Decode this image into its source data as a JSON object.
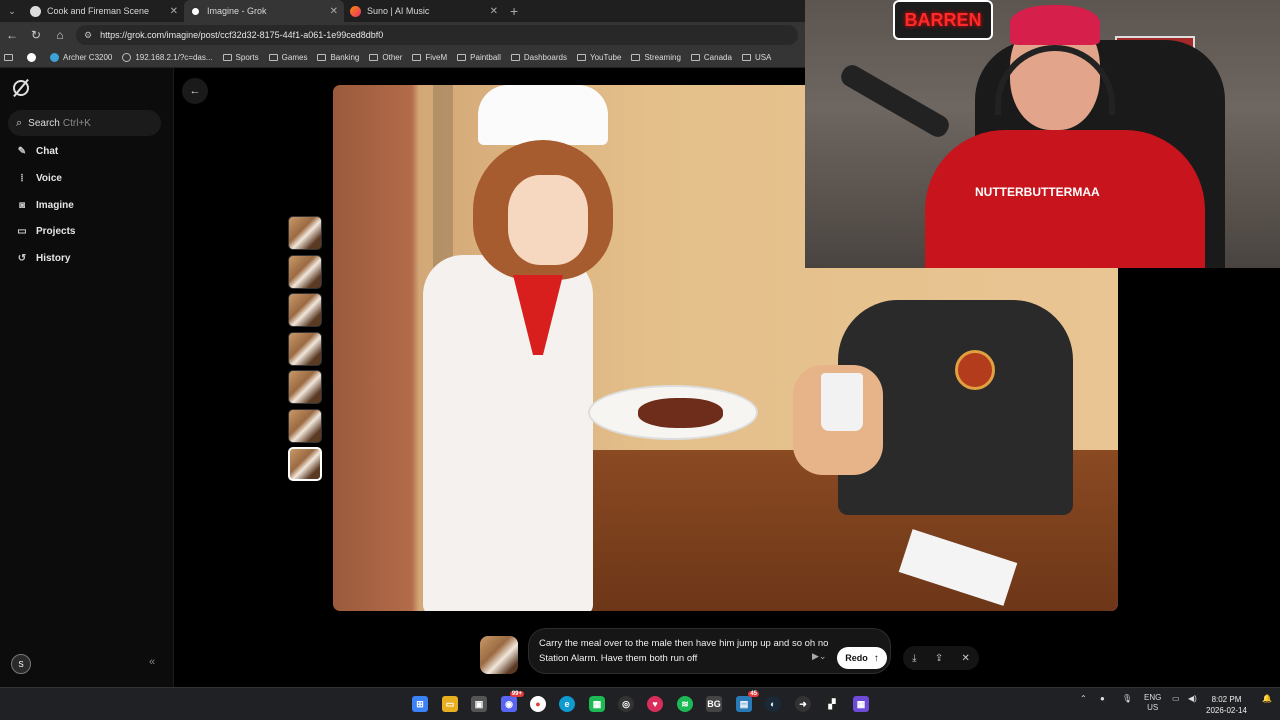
{
  "browser": {
    "tabs": [
      {
        "title": "Cook and Fireman Scene",
        "icon": "chat-bubble-icon"
      },
      {
        "title": "Imagine - Grok",
        "icon": "grok-logo-icon"
      },
      {
        "title": "Suno | AI Music",
        "icon": "suno-logo-icon"
      }
    ],
    "url": "https://grok.com/imagine/post/ccf32d32-8175-44f1-a061-1e99ced8dbf0",
    "bookmarks": [
      {
        "label": "",
        "icon": "google-icon"
      },
      {
        "label": "Archer C3200",
        "icon": "router-icon"
      },
      {
        "label": "192.168.2.1/?c=das...",
        "icon": "globe-icon"
      },
      {
        "label": "Sports",
        "icon": "folder-icon"
      },
      {
        "label": "Games",
        "icon": "folder-icon"
      },
      {
        "label": "Banking",
        "icon": "folder-icon"
      },
      {
        "label": "Other",
        "icon": "folder-icon"
      },
      {
        "label": "FiveM",
        "icon": "folder-icon"
      },
      {
        "label": "Paintball",
        "icon": "folder-icon"
      },
      {
        "label": "Dashboards",
        "icon": "folder-icon"
      },
      {
        "label": "YouTube",
        "icon": "folder-icon"
      },
      {
        "label": "Streaming",
        "icon": "folder-icon"
      },
      {
        "label": "Canada",
        "icon": "folder-icon"
      },
      {
        "label": "USA",
        "icon": "folder-icon"
      }
    ]
  },
  "sidebar": {
    "search_label": "Search",
    "search_shortcut": "Ctrl+K",
    "items": [
      {
        "label": "Chat",
        "icon": "chat-pencil-icon"
      },
      {
        "label": "Voice",
        "icon": "waveform-icon"
      },
      {
        "label": "Imagine",
        "icon": "image-icon"
      },
      {
        "label": "Projects",
        "icon": "folder-icon"
      },
      {
        "label": "History",
        "icon": "history-icon"
      }
    ],
    "avatar_initial": "S"
  },
  "composer": {
    "prompt": "Carry the meal over to the male then have him jump up and so oh no Station Alarm.  Have them both run off",
    "redo_label": "Redo"
  },
  "webcam": {
    "sign_text": "BARREN",
    "hoodie_text": "NUTTERBUTTERMAA"
  },
  "taskbar": {
    "discord_badge": "99+",
    "steam_badge": "45",
    "lang": "ENG",
    "region": "US",
    "time": "8:02 PM",
    "date": "2026-02-14"
  }
}
